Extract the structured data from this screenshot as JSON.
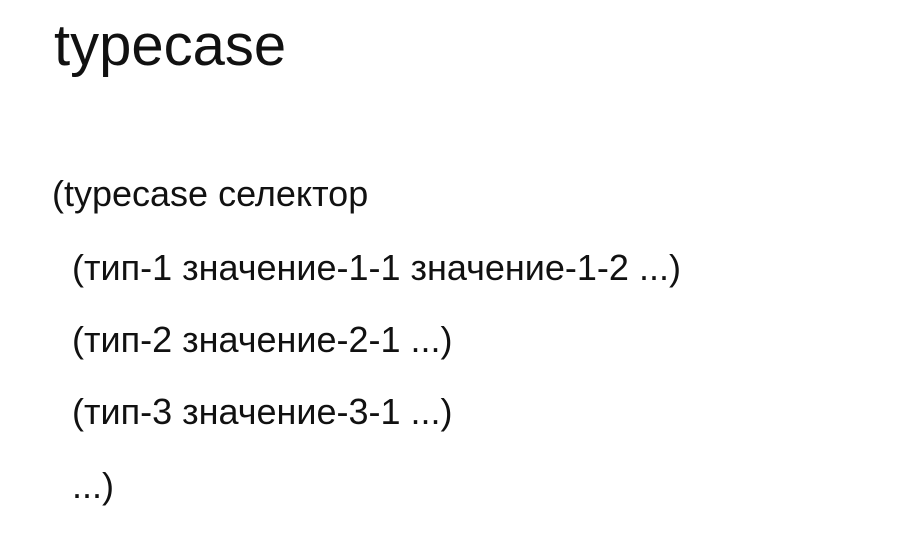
{
  "slide": {
    "title": "typecase",
    "lines": [
      "(typecase селектор",
      "(тип-1 значение-1-1 значение-1-2 ...)",
      "(тип-2 значение-2-1 ...)",
      "(тип-3 значение-3-1 ...)",
      "...)"
    ]
  }
}
